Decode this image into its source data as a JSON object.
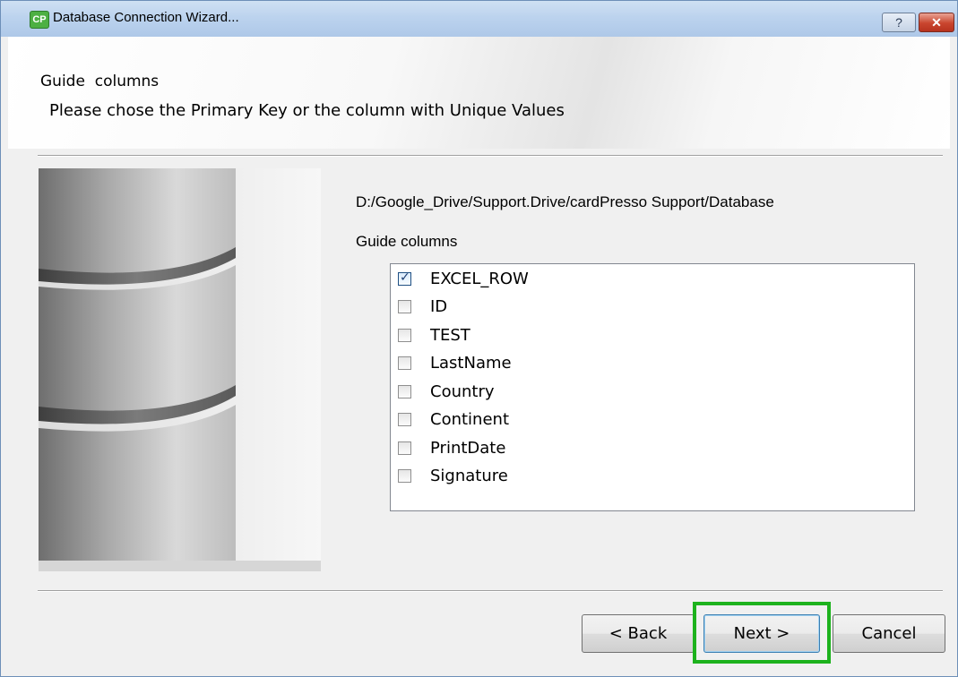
{
  "window": {
    "title": "Database Connection Wizard...",
    "app_icon_text": "CP",
    "help_label": "?",
    "close_label": "✕"
  },
  "header": {
    "title": "Guide  columns",
    "subtitle": "Please chose the Primary Key or the column with Unique Values"
  },
  "main": {
    "path": "D:/Google_Drive/Support.Drive/cardPresso Support/Database",
    "list_label": "Guide columns",
    "columns": [
      {
        "label": "EXCEL_ROW",
        "checked": true
      },
      {
        "label": "ID",
        "checked": false
      },
      {
        "label": "TEST",
        "checked": false
      },
      {
        "label": "LastName",
        "checked": false
      },
      {
        "label": "Country",
        "checked": false
      },
      {
        "label": "Continent",
        "checked": false
      },
      {
        "label": "PrintDate",
        "checked": false
      },
      {
        "label": "Signature",
        "checked": false
      }
    ]
  },
  "buttons": {
    "back": "< Back",
    "next": "Next >",
    "cancel": "Cancel"
  },
  "colors": {
    "highlight": "#1db21d",
    "titlebar": "#bcd3ee"
  }
}
